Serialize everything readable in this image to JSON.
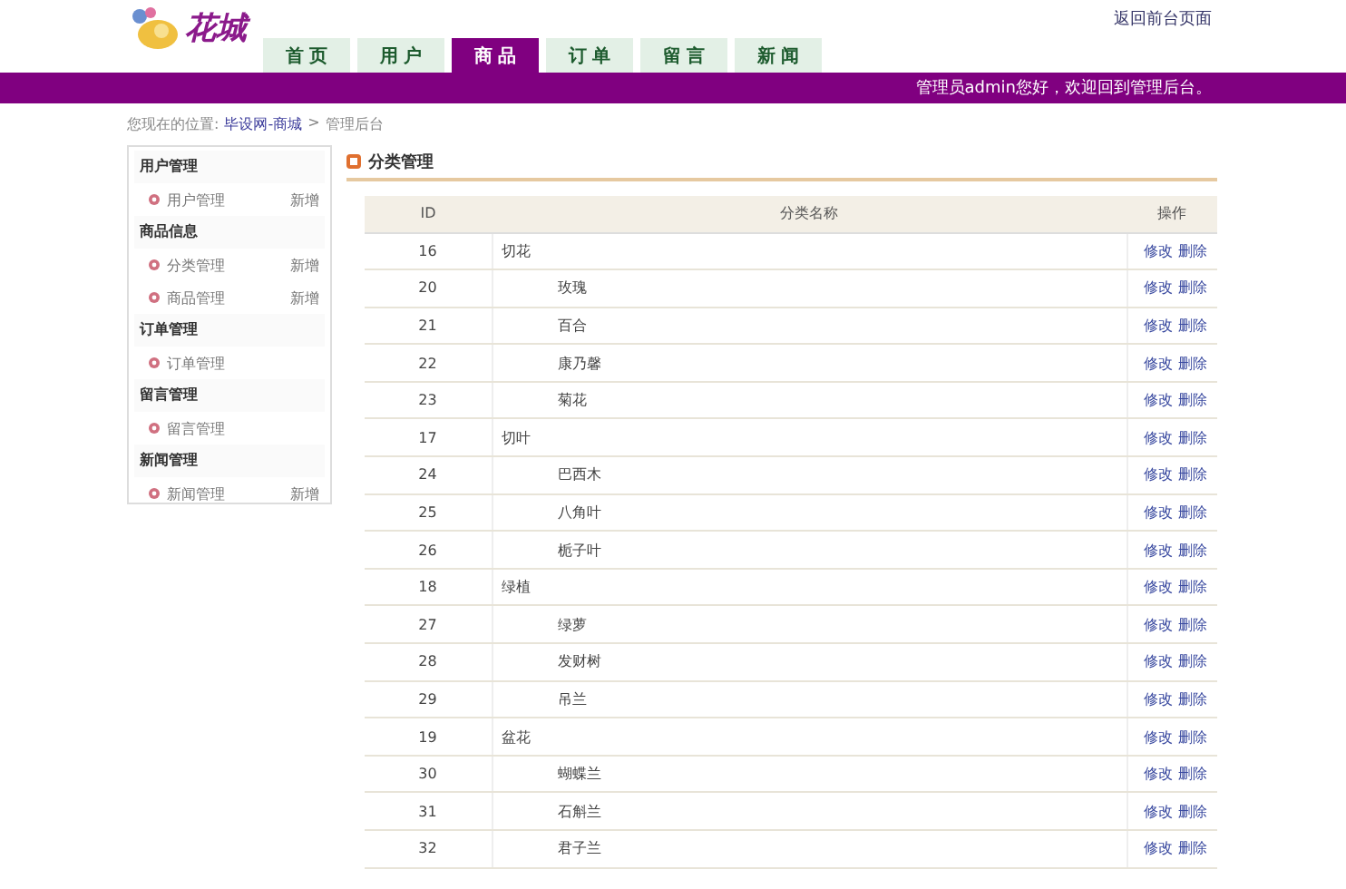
{
  "header": {
    "logo_text": "花城",
    "top_link": "返回前台页面",
    "nav": [
      {
        "label": "首 页",
        "selected": false
      },
      {
        "label": "用 户",
        "selected": false
      },
      {
        "label": "商 品",
        "selected": true
      },
      {
        "label": "订 单",
        "selected": false
      },
      {
        "label": "留 言",
        "selected": false
      },
      {
        "label": "新 闻",
        "selected": false
      }
    ],
    "welcome": "管理员admin您好，欢迎回到管理后台。"
  },
  "breadcrumb": {
    "label": "您现在的位置:",
    "links": [
      "毕设网-商城"
    ],
    "separator": ">",
    "current": "管理后台"
  },
  "sidebar": [
    {
      "title": "用户管理",
      "items": [
        {
          "label": "用户管理",
          "action": "新增"
        }
      ]
    },
    {
      "title": "商品信息",
      "items": [
        {
          "label": "分类管理",
          "action": "新增"
        },
        {
          "label": "商品管理",
          "action": "新增"
        }
      ]
    },
    {
      "title": "订单管理",
      "items": [
        {
          "label": "订单管理"
        }
      ]
    },
    {
      "title": "留言管理",
      "items": [
        {
          "label": "留言管理"
        }
      ]
    },
    {
      "title": "新闻管理",
      "items": [
        {
          "label": "新闻管理",
          "action": "新增"
        }
      ]
    }
  ],
  "panel": {
    "title": "分类管理",
    "table": {
      "columns": [
        "ID",
        "分类名称",
        "操作"
      ],
      "rows": [
        {
          "id": "16",
          "name": "切花",
          "actions": [
            "修改",
            "删除"
          ],
          "children": [
            {
              "id": "20",
              "name": "玫瑰",
              "actions": [
                "修改",
                "删除"
              ]
            },
            {
              "id": "21",
              "name": "百合",
              "actions": [
                "修改",
                "删除"
              ]
            },
            {
              "id": "22",
              "name": "康乃馨",
              "actions": [
                "修改",
                "删除"
              ]
            },
            {
              "id": "23",
              "name": "菊花",
              "actions": [
                "修改",
                "删除"
              ]
            }
          ]
        },
        {
          "id": "17",
          "name": "切叶",
          "actions": [
            "修改",
            "删除"
          ],
          "children": [
            {
              "id": "24",
              "name": "巴西木",
              "actions": [
                "修改",
                "删除"
              ]
            },
            {
              "id": "25",
              "name": "八角叶",
              "actions": [
                "修改",
                "删除"
              ]
            },
            {
              "id": "26",
              "name": "栀子叶",
              "actions": [
                "修改",
                "删除"
              ]
            }
          ]
        },
        {
          "id": "18",
          "name": "绿植",
          "actions": [
            "修改",
            "删除"
          ],
          "children": [
            {
              "id": "27",
              "name": "绿萝",
              "actions": [
                "修改",
                "删除"
              ]
            },
            {
              "id": "28",
              "name": "发财树",
              "actions": [
                "修改",
                "删除"
              ]
            },
            {
              "id": "29",
              "name": "吊兰",
              "actions": [
                "修改",
                "删除"
              ]
            }
          ]
        },
        {
          "id": "19",
          "name": "盆花",
          "actions": [
            "修改",
            "删除"
          ],
          "children": [
            {
              "id": "30",
              "name": "蝴蝶兰",
              "actions": [
                "修改",
                "删除"
              ]
            },
            {
              "id": "31",
              "name": "石斛兰",
              "actions": [
                "修改",
                "删除"
              ]
            },
            {
              "id": "32",
              "name": "君子兰",
              "actions": [
                "修改",
                "删除"
              ]
            }
          ]
        }
      ]
    }
  }
}
